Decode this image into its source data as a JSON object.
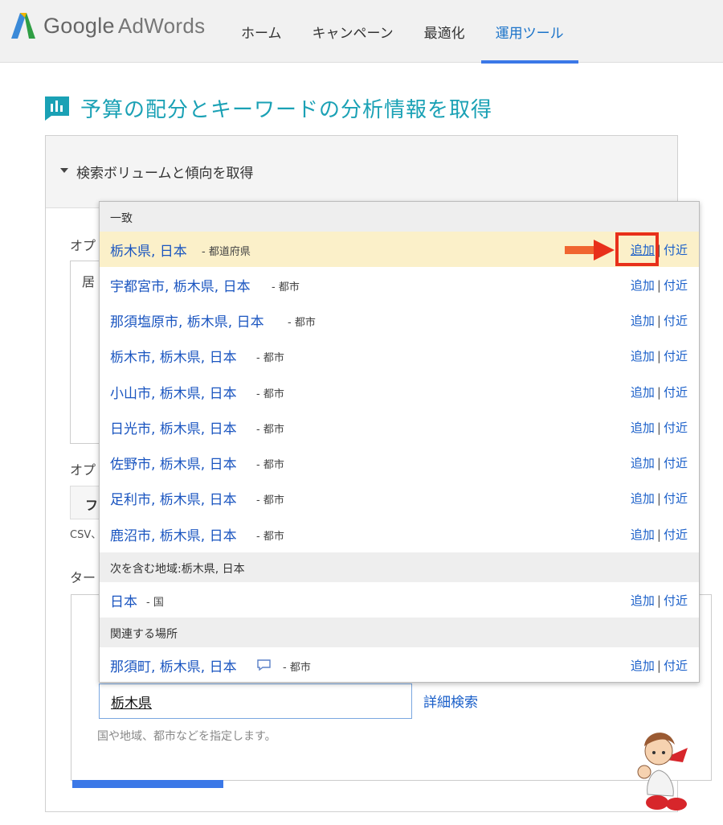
{
  "brand": {
    "google": "Google",
    "product": "AdWords"
  },
  "nav": [
    {
      "label": "ホーム",
      "active": false
    },
    {
      "label": "キャンペーン",
      "active": false
    },
    {
      "label": "最適化",
      "active": false
    },
    {
      "label": "運用ツール",
      "active": true
    }
  ],
  "page_title": "予算の配分とキーワードの分析情報を取得",
  "panel": {
    "section_label": "検索ボリュームと傾向を取得",
    "partial_option_1": "オプ",
    "partial_textarea": "居",
    "partial_option_2": "オプ",
    "partial_button": "フ",
    "partial_csv": "CSV、",
    "partial_target": "ター"
  },
  "location_search": {
    "value": "栃木県",
    "detail_link": "詳細検索",
    "hint": "国や地域、都市などを指定します。"
  },
  "dropdown": {
    "sections": [
      {
        "header": "一致",
        "rows": [
          {
            "location": "栃木県, 日本",
            "type": "- 都道府県",
            "highlight": true
          },
          {
            "location": "宇都宮市, 栃木県, 日本",
            "type": "- 都市"
          },
          {
            "location": "那須塩原市, 栃木県, 日本",
            "type": "- 都市"
          },
          {
            "location": "栃木市, 栃木県, 日本",
            "type": "- 都市"
          },
          {
            "location": "小山市, 栃木県, 日本",
            "type": "- 都市"
          },
          {
            "location": "日光市, 栃木県, 日本",
            "type": "- 都市"
          },
          {
            "location": "佐野市, 栃木県, 日本",
            "type": "- 都市"
          },
          {
            "location": "足利市, 栃木県, 日本",
            "type": "- 都市"
          },
          {
            "location": "鹿沼市, 栃木県, 日本",
            "type": "- 都市"
          }
        ]
      },
      {
        "header": "次を含む地域:栃木県, 日本",
        "rows": [
          {
            "location": "日本",
            "type": "- 国"
          }
        ]
      },
      {
        "header": "関連する場所",
        "rows": [
          {
            "location": "那須町, 栃木県, 日本",
            "type": "- 都市",
            "icon": "comment-bubble-icon"
          }
        ]
      }
    ],
    "add_label": "追加",
    "separator": "|",
    "nearby_label": "付近"
  },
  "colors": {
    "accent_blue": "#1a5fc9",
    "title_teal": "#1aa1b5",
    "highlight": "#fbf0c9",
    "annotation_red": "#e8301a"
  }
}
